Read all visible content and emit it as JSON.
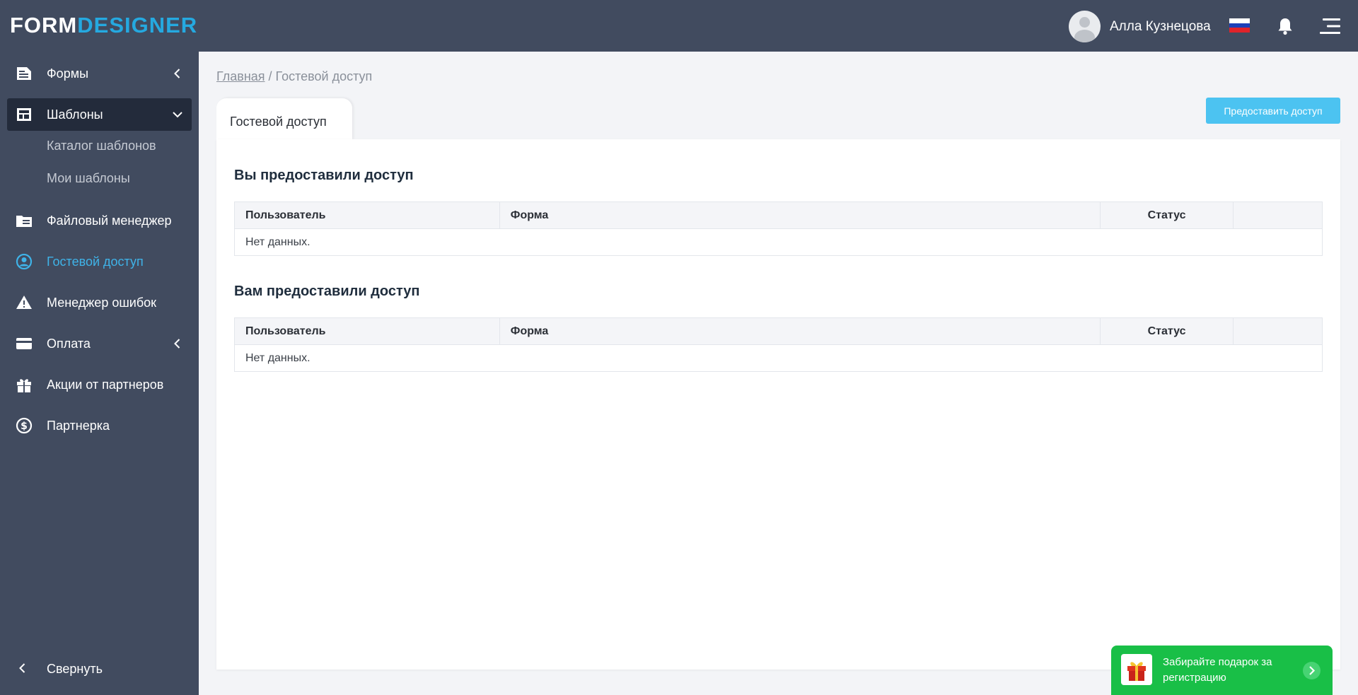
{
  "header": {
    "logo_part1": "FORM",
    "logo_part2": "DESIGNER",
    "user_name": "Алла Кузнецова",
    "colors": {
      "bar": "#414b5f",
      "accent": "#25a9e0"
    }
  },
  "sidebar": {
    "items": [
      {
        "label": "Формы",
        "icon": "document-icon"
      },
      {
        "label": "Шаблоны",
        "icon": "layout-icon"
      },
      {
        "label": "Каталог шаблонов"
      },
      {
        "label": "Мои шаблоны"
      },
      {
        "label": "Файловый менеджер",
        "icon": "folder-icon"
      },
      {
        "label": "Гостевой доступ",
        "icon": "user-circle-icon"
      },
      {
        "label": "Менеджер ошибок",
        "icon": "warning-icon"
      },
      {
        "label": "Оплата",
        "icon": "card-icon"
      },
      {
        "label": "Акции от партнеров",
        "icon": "gift-icon"
      },
      {
        "label": "Партнерка",
        "icon": "dollar-icon"
      }
    ],
    "collapse_label": "Свернуть"
  },
  "breadcrumb": {
    "home": "Главная",
    "separator": " / ",
    "current": "Гостевой доступ"
  },
  "main": {
    "tab_label": "Гостевой доступ",
    "grant_button": "Предоставить доступ",
    "sections": [
      {
        "title": "Вы предоставили доступ",
        "columns": [
          "Пользователь",
          "Форма",
          "Статус",
          ""
        ],
        "empty_text": "Нет данных."
      },
      {
        "title": "Вам предоставили доступ",
        "columns": [
          "Пользователь",
          "Форма",
          "Статус",
          ""
        ],
        "empty_text": "Нет данных."
      }
    ]
  },
  "promo": {
    "text": "Забирайте подарок за регистрацию",
    "color": "#19bf47"
  }
}
